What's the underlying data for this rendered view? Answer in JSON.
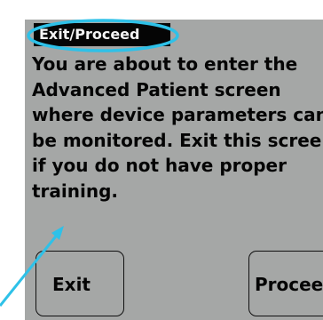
{
  "dialog": {
    "title": "Exit/Proceed",
    "message_lines": [
      "You are about to enter the",
      "Advanced Patient screen",
      "where device parameters can",
      "be monitored.  Exit this screen",
      "if you do not have proper",
      "training."
    ],
    "exit_label": "Exit",
    "proceed_label": "Proceed"
  },
  "annotation": {
    "color": "#2ec1e8"
  }
}
